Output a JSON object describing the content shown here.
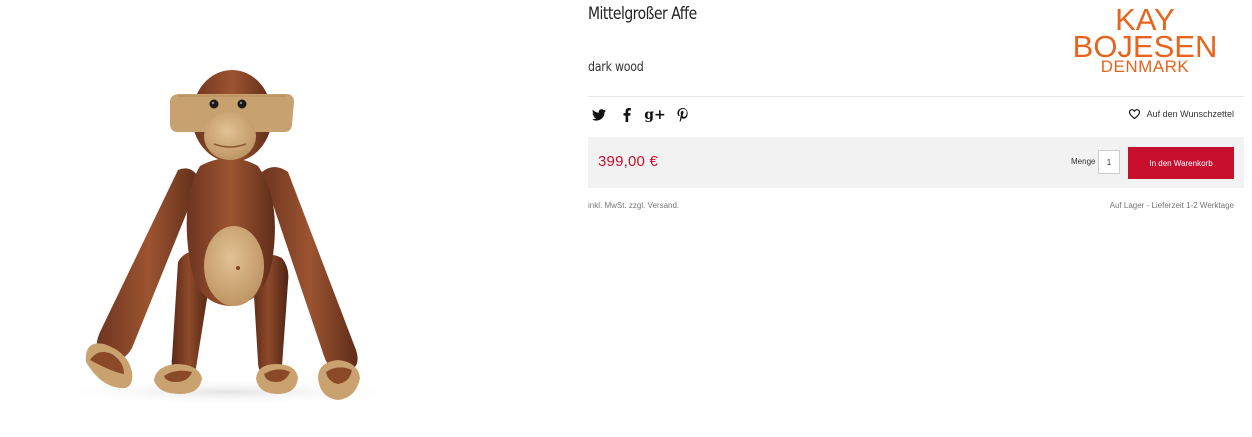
{
  "product": {
    "title": "Mittelgroßer Affe",
    "variant": "dark wood",
    "image_subject": "wooden-monkey-figure"
  },
  "brand": {
    "line1": "KAY",
    "line2": "BOJESEN",
    "line3": "DENMARK",
    "color": "#e8641c"
  },
  "share": {
    "icons": [
      "twitter-icon",
      "facebook-icon",
      "google-plus-icon",
      "pinterest-icon"
    ],
    "google_plus_glyph": "g+"
  },
  "wishlist": {
    "label": "Auf den Wunschzettel",
    "icon": "heart-icon"
  },
  "purchase": {
    "price": "399,00 €",
    "price_color": "#c8102e",
    "quantity_label": "Menge",
    "quantity_value": "1",
    "add_to_cart_label": "In den Warenkorb",
    "button_color": "#c8102e"
  },
  "notes": {
    "tax": "inkl. MwSt. zzgl. Versand.",
    "delivery": "Auf Lager - Lieferzeit 1-2 Werktage"
  }
}
